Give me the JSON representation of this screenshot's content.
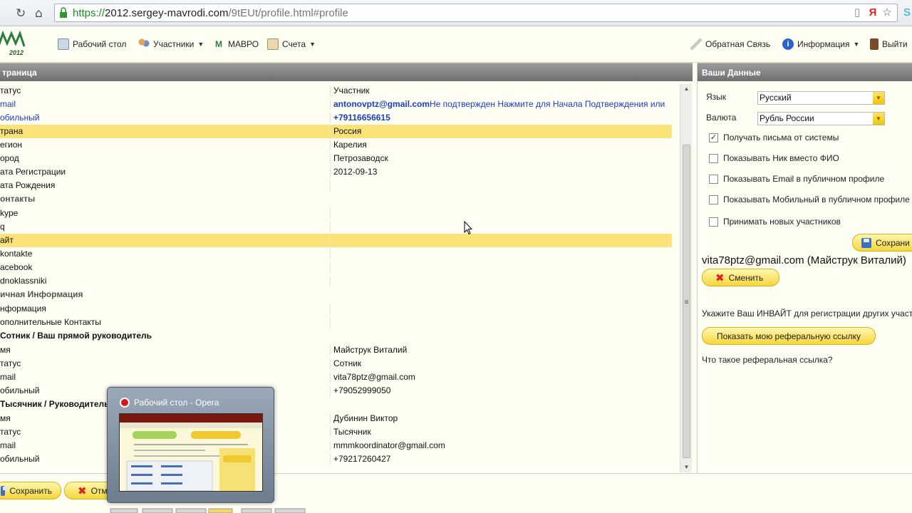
{
  "browser": {
    "url_scheme": "https://",
    "url_host": "2012.sergey-mavrodi.com",
    "url_path": "/9tEUt/profile.html#profile"
  },
  "topmenu": {
    "logo_text": "2012",
    "items": [
      {
        "label": "Рабочий стол",
        "icon": "desktop-icon"
      },
      {
        "label": "Участники",
        "icon": "users-icon"
      },
      {
        "label": "МАВРО",
        "icon": "mavro-icon"
      },
      {
        "label": "Счета",
        "icon": "accounts-icon"
      }
    ],
    "right_items": [
      {
        "label": "Обратная Связь",
        "icon": "feedback-icon"
      },
      {
        "label": "Информация",
        "icon": "info-icon"
      },
      {
        "label": "Выйти",
        "icon": "exit-icon"
      }
    ]
  },
  "left": {
    "header": "траница",
    "rows": [
      {
        "label": "татус",
        "value": "Участник"
      },
      {
        "label": "mail",
        "value": "antonovptz@gmail.com",
        "note": " Не подтвержден Нажмите для Начала Подтверждения или"
      },
      {
        "label": "обильный",
        "value": "+79116656615"
      },
      {
        "label": "трана",
        "value": "Россия"
      },
      {
        "label": "егион",
        "value": "Карелия"
      },
      {
        "label": "ород",
        "value": "Петрозаводск"
      },
      {
        "label": "ата Регистрации",
        "value": "2012-09-13"
      },
      {
        "label": "ата Рождения",
        "value": ""
      },
      {
        "label": "онтакты",
        "value": ""
      },
      {
        "label": "kype",
        "value": ""
      },
      {
        "label": "q",
        "value": ""
      },
      {
        "label": "айт",
        "value": ""
      },
      {
        "label": "kontakte",
        "value": ""
      },
      {
        "label": "acebook",
        "value": ""
      },
      {
        "label": "dnoklassniki",
        "value": ""
      },
      {
        "label": "ичная Информация",
        "value": ""
      },
      {
        "label": "нформация",
        "value": ""
      },
      {
        "label": "ополнительные Контакты",
        "value": ""
      },
      {
        "label": "Сотник / Ваш прямой руководитель",
        "value": ""
      },
      {
        "label": "мя",
        "value": "Майструк Виталий"
      },
      {
        "label": "татус",
        "value": "Сотник"
      },
      {
        "label": "mail",
        "value": "vita78ptz@gmail.com"
      },
      {
        "label": "обильный",
        "value": "+79052999050"
      },
      {
        "label": "Тысячник / Руководитель",
        "value": ""
      },
      {
        "label": "мя",
        "value": "Дубинин Виктор"
      },
      {
        "label": "татус",
        "value": "Тысячник"
      },
      {
        "label": "mail",
        "value": "mmmkoordinator@gmail.com"
      },
      {
        "label": "обильный",
        "value": "+79217260427"
      }
    ]
  },
  "right": {
    "header": "Ваши Данные",
    "language_label": "Язык",
    "language_value": "Русский",
    "currency_label": "Валюта",
    "currency_value": "Рубль России",
    "checkboxes": [
      {
        "label": "Получать письма от системы",
        "checked": true
      },
      {
        "label": "Показывать Ник вместо ФИО",
        "checked": false
      },
      {
        "label": "Показывать Email в публичном профиле",
        "checked": false
      },
      {
        "label": "Показывать Мобильный в публичном профиле",
        "checked": false
      },
      {
        "label": "Принимать новых участников",
        "checked": false
      }
    ],
    "save_label": "Сохрани",
    "account_line": "vita78ptz@gmail.com (Майструк Виталий)",
    "change_label": "Сменить",
    "invite_text": "Укажите Ваш ИНВАЙТ для регистрации других участ",
    "referral_button": "Показать мою реферальную ссылку",
    "referral_question": "Что такое реферальная ссылка?"
  },
  "bottom": {
    "save_label": "Сохранить",
    "cancel_label": "Отм"
  },
  "popup": {
    "title": "Рабочий стол - Opera"
  },
  "colors": {
    "highlight": "#fbe37a",
    "button_yellow": "#f6d63b",
    "link_blue": "#1a3ec4"
  }
}
